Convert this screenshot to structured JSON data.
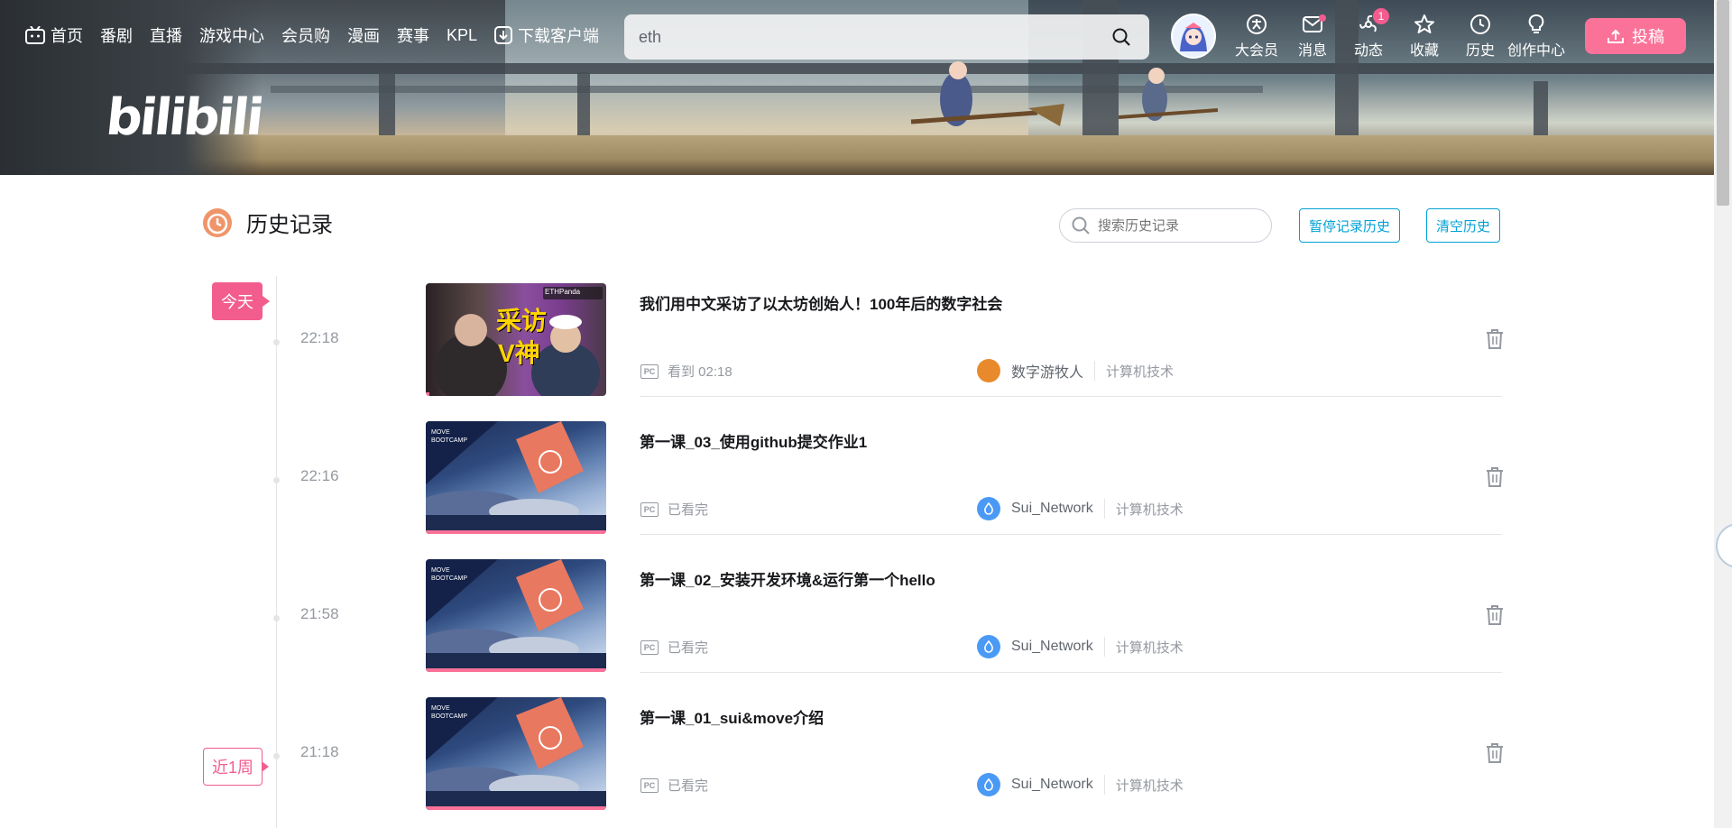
{
  "nav": {
    "items": [
      {
        "label": "首页",
        "icon": "tv-icon"
      },
      {
        "label": "番剧"
      },
      {
        "label": "直播"
      },
      {
        "label": "游戏中心"
      },
      {
        "label": "会员购"
      },
      {
        "label": "漫画"
      },
      {
        "label": "赛事"
      },
      {
        "label": "KPL"
      },
      {
        "label": "下载客户端",
        "icon": "download-icon"
      }
    ],
    "search_value": "eth",
    "right_menu": [
      {
        "label": "大会员",
        "icon": "vip-icon"
      },
      {
        "label": "消息",
        "icon": "message-icon",
        "dot": true
      },
      {
        "label": "动态",
        "icon": "dynamic-icon",
        "badge": "1"
      },
      {
        "label": "收藏",
        "icon": "star-icon"
      },
      {
        "label": "历史",
        "icon": "history-icon"
      },
      {
        "label": "创作中心",
        "icon": "bulb-icon"
      }
    ],
    "upload_label": "投稿",
    "logo_text": "bilibili"
  },
  "history": {
    "title": "历史记录",
    "search_placeholder": "搜索历史记录",
    "pause_label": "暂停记录历史",
    "clear_label": "清空历史",
    "tag_today": "今天",
    "tag_week": "近1周",
    "entries": [
      {
        "time": "22:18",
        "title": "我们用中文采访了以太坊创始人！100年后的数字社会",
        "progress": "看到  02:18",
        "progress_fraction": 0.02,
        "uploader": "数字游牧人",
        "category": "计算机技术",
        "thumb_text_1": "采访",
        "thumb_text_2": "V神",
        "thumb_tag": "ETHPanda"
      },
      {
        "time": "22:16",
        "title": "第一课_03_使用github提交作业1",
        "progress": "已看完",
        "progress_fraction": 1,
        "uploader": "Sui_Network",
        "category": "计算机技术",
        "thumb_tag": "MOVE BOOTCAMP"
      },
      {
        "time": "21:58",
        "title": "第一课_02_安装开发环境&运行第一个hello",
        "progress": "已看完",
        "progress_fraction": 1,
        "uploader": "Sui_Network",
        "category": "计算机技术",
        "thumb_tag": "MOVE BOOTCAMP"
      },
      {
        "time": "21:18",
        "title": "第一课_01_sui&move介绍",
        "progress": "已看完",
        "progress_fraction": 1,
        "uploader": "Sui_Network",
        "category": "计算机技术",
        "thumb_tag": "MOVE BOOTCAMP"
      }
    ]
  },
  "colors": {
    "accent": "#fb7299",
    "link": "#00a1d6",
    "badge": "#f25d8e"
  }
}
